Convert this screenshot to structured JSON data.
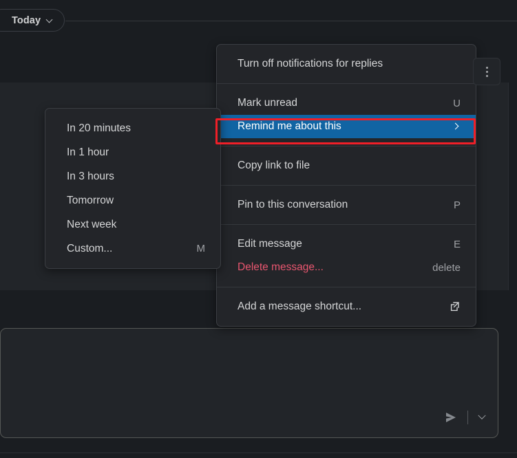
{
  "header": {
    "today_pill_label": "Today",
    "today_pill_chevron_icon": "chevron-down-icon"
  },
  "message_actions": {
    "kebab_icon": "more-actions-icon",
    "groups": [
      {
        "items": [
          {
            "label": "Turn off notifications for replies",
            "accelerator": "",
            "kind": "normal"
          }
        ]
      },
      {
        "items": [
          {
            "label": "Mark unread",
            "accelerator": "U",
            "kind": "normal"
          },
          {
            "label": "Remind me about this",
            "accelerator": "",
            "kind": "submenu",
            "selected": true,
            "chevron_icon": "chevron-right-icon"
          }
        ]
      },
      {
        "items": [
          {
            "label": "Copy link to file",
            "accelerator": "",
            "kind": "normal"
          }
        ]
      },
      {
        "items": [
          {
            "label": "Pin to this conversation",
            "accelerator": "P",
            "kind": "normal"
          }
        ]
      },
      {
        "items": [
          {
            "label": "Edit message",
            "accelerator": "E",
            "kind": "normal"
          },
          {
            "label": "Delete message...",
            "accelerator": "delete",
            "kind": "danger"
          }
        ]
      },
      {
        "items": [
          {
            "label": "Add a message shortcut...",
            "accelerator": "",
            "kind": "external",
            "icon": "external-link-icon"
          }
        ]
      }
    ]
  },
  "reminder_submenu": {
    "items": [
      {
        "label": "In 20 minutes",
        "accelerator": ""
      },
      {
        "label": "In 1 hour",
        "accelerator": ""
      },
      {
        "label": "In 3 hours",
        "accelerator": ""
      },
      {
        "label": "Tomorrow",
        "accelerator": ""
      },
      {
        "label": "Next week",
        "accelerator": ""
      },
      {
        "label": "Custom...",
        "accelerator": "M"
      }
    ]
  },
  "composer": {
    "value": "",
    "placeholder": "",
    "send_icon": "send-icon",
    "send_options_icon": "chevron-down-icon"
  },
  "colors": {
    "app_background": "#1a1d21",
    "hover_row_background": "#222529",
    "menu_background": "#232529",
    "menu_border": "#3b3e43",
    "selected_blue": "#1164a3",
    "danger_text": "#e8566f",
    "annotation_red": "#f01f28",
    "primary_text": "#d5d6d7",
    "secondary_text": "#9fa1a5"
  }
}
